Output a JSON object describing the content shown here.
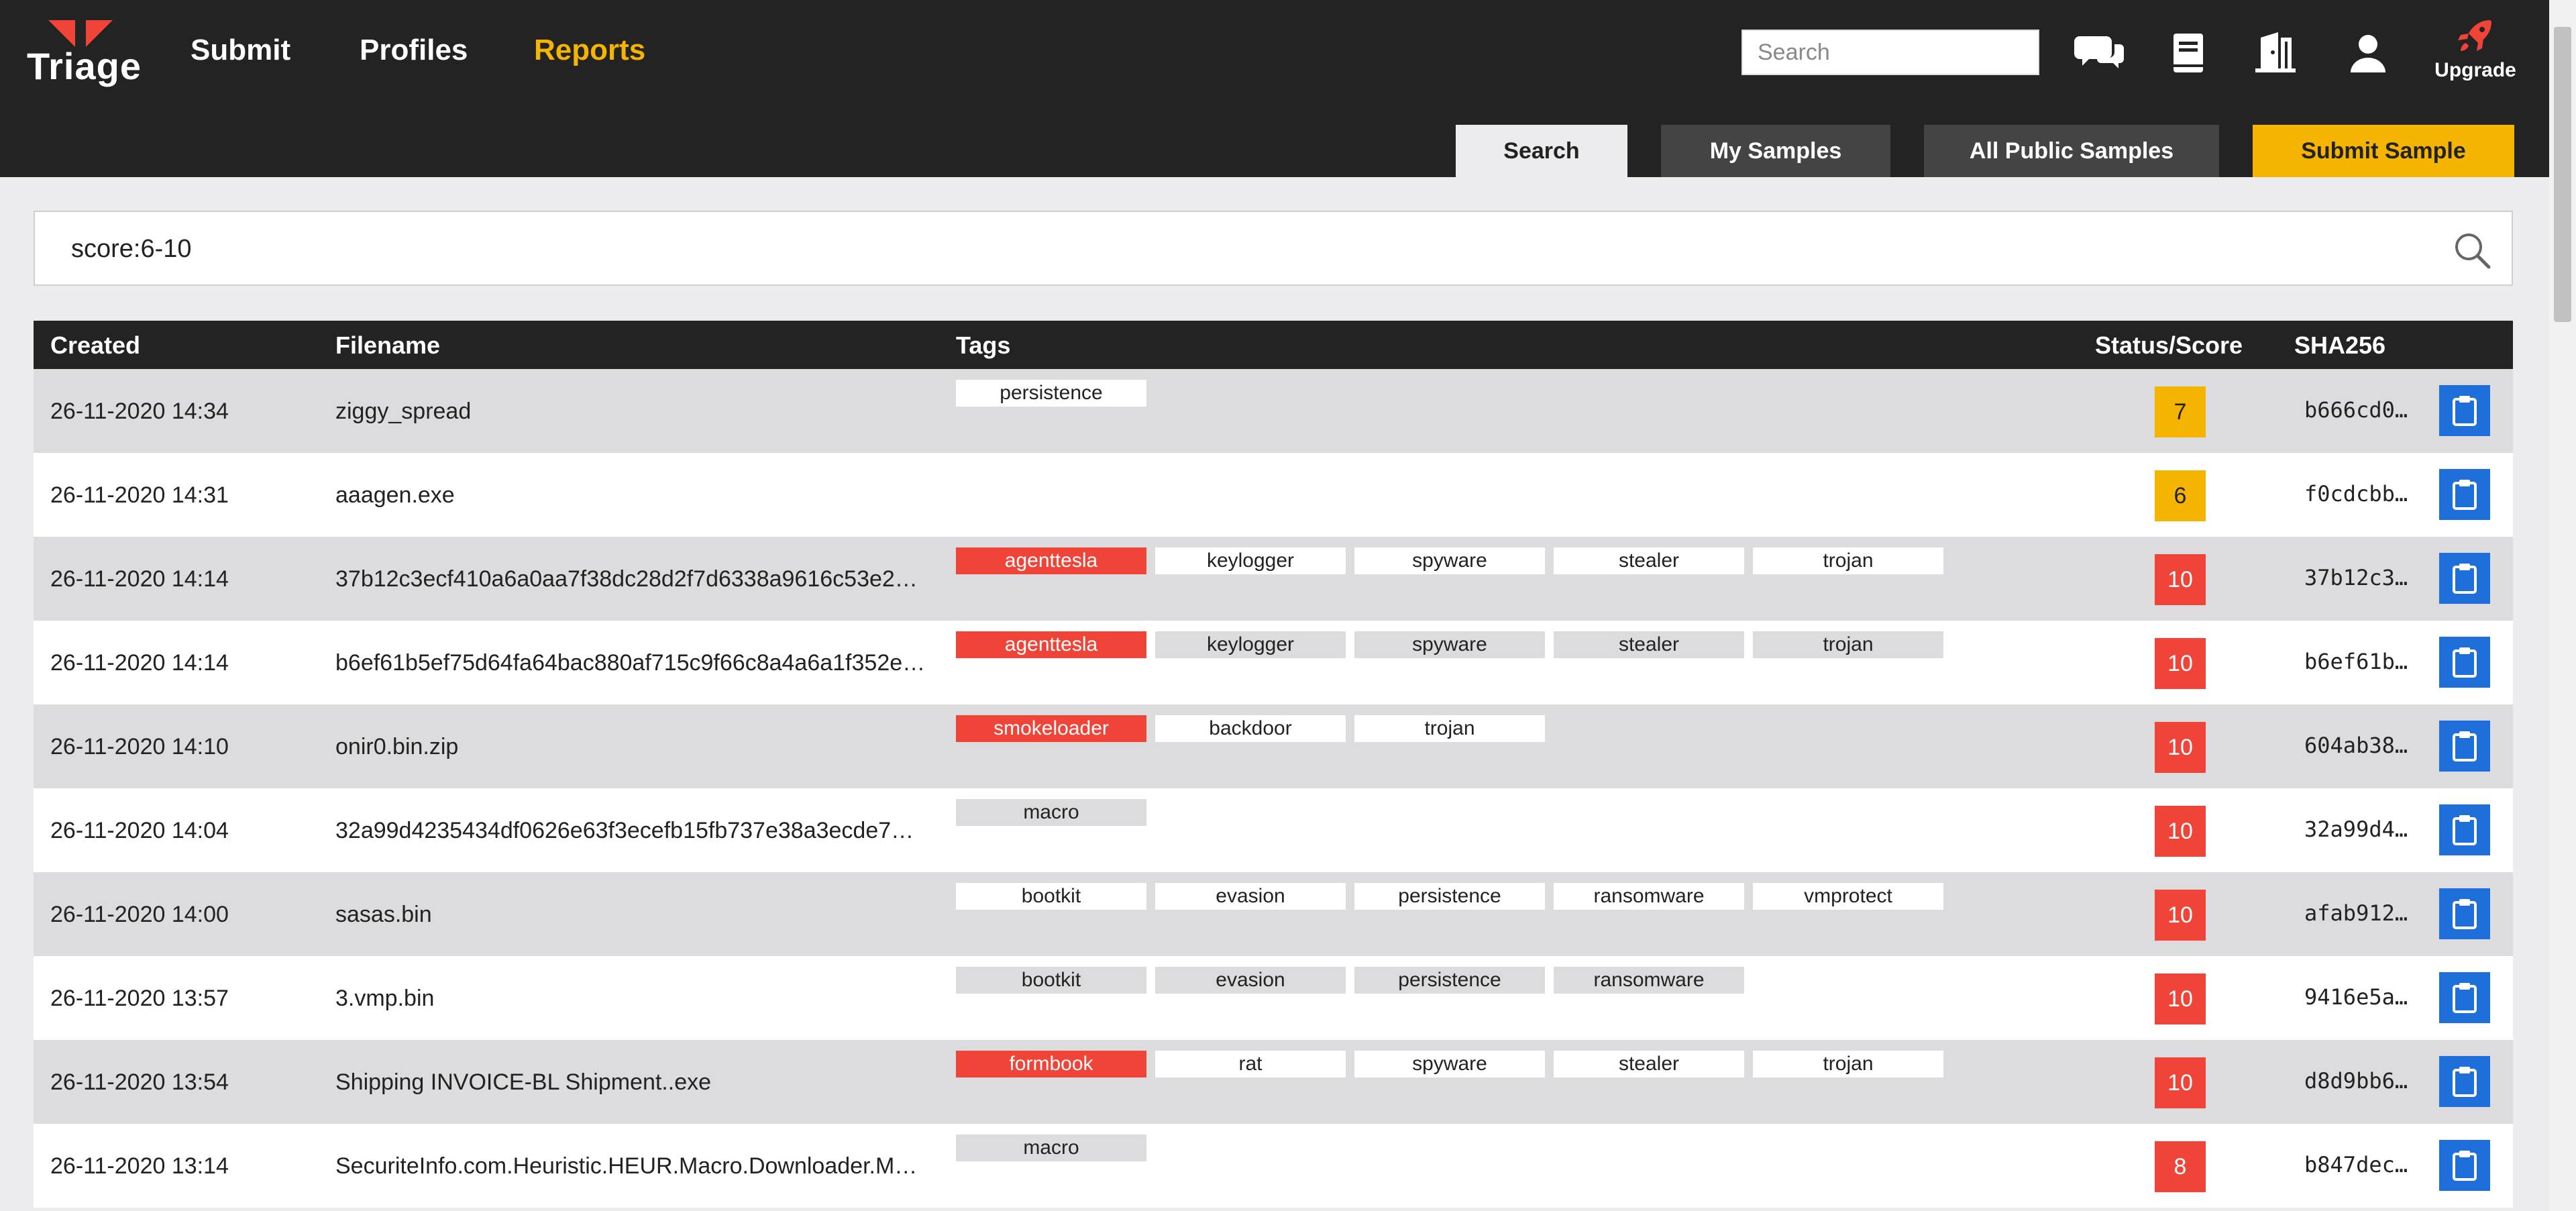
{
  "brand": {
    "name": "Triage",
    "accent": "#f04438"
  },
  "nav": {
    "links": [
      {
        "label": "Submit",
        "active": false
      },
      {
        "label": "Profiles",
        "active": false
      },
      {
        "label": "Reports",
        "active": true
      }
    ]
  },
  "header": {
    "search_placeholder": "Search",
    "icons": [
      "chat-icon",
      "book-icon",
      "door-icon",
      "user-icon",
      "rocket-icon"
    ],
    "upgrade_label": "Upgrade"
  },
  "tabs": [
    {
      "label": "Search",
      "selected": true
    },
    {
      "label": "My Samples",
      "selected": false
    },
    {
      "label": "All Public Samples",
      "selected": false
    },
    {
      "label": "Submit Sample",
      "highlight": true
    }
  ],
  "query": {
    "value": "score:6-10"
  },
  "table": {
    "columns": [
      "Created",
      "Filename",
      "Tags",
      "Status/Score",
      "SHA256"
    ],
    "rows": [
      {
        "created": "26-11-2020 14:34",
        "filename": "ziggy_spread",
        "tags": [
          {
            "label": "persistence",
            "family": false
          }
        ],
        "score": "7",
        "score_color": "yellow",
        "sha": "b666cd0…"
      },
      {
        "created": "26-11-2020 14:31",
        "filename": "aaagen.exe",
        "tags": [],
        "score": "6",
        "score_color": "yellow",
        "sha": "f0cdcbb…"
      },
      {
        "created": "26-11-2020 14:14",
        "filename": "37b12c3ecf410a6a0aa7f38dc28d2f7d6338a9616c53e2…",
        "tags": [
          {
            "label": "agenttesla",
            "family": true
          },
          {
            "label": "keylogger",
            "family": false
          },
          {
            "label": "spyware",
            "family": false
          },
          {
            "label": "stealer",
            "family": false
          },
          {
            "label": "trojan",
            "family": false
          }
        ],
        "score": "10",
        "score_color": "red",
        "sha": "37b12c3…"
      },
      {
        "created": "26-11-2020 14:14",
        "filename": "b6ef61b5ef75d64fa64bac880af715c9f66c8a4a6a1f352e…",
        "tags": [
          {
            "label": "agenttesla",
            "family": true
          },
          {
            "label": "keylogger",
            "family": false
          },
          {
            "label": "spyware",
            "family": false
          },
          {
            "label": "stealer",
            "family": false
          },
          {
            "label": "trojan",
            "family": false
          }
        ],
        "score": "10",
        "score_color": "red",
        "sha": "b6ef61b…"
      },
      {
        "created": "26-11-2020 14:10",
        "filename": "onir0.bin.zip",
        "tags": [
          {
            "label": "smokeloader",
            "family": true
          },
          {
            "label": "backdoor",
            "family": false
          },
          {
            "label": "trojan",
            "family": false
          }
        ],
        "score": "10",
        "score_color": "red",
        "sha": "604ab38…"
      },
      {
        "created": "26-11-2020 14:04",
        "filename": "32a99d4235434df0626e63f3ecefb15fb737e38a3ecde7…",
        "tags": [
          {
            "label": "macro",
            "family": false
          }
        ],
        "score": "10",
        "score_color": "red",
        "sha": "32a99d4…"
      },
      {
        "created": "26-11-2020 14:00",
        "filename": "sasas.bin",
        "tags": [
          {
            "label": "bootkit",
            "family": false
          },
          {
            "label": "evasion",
            "family": false
          },
          {
            "label": "persistence",
            "family": false
          },
          {
            "label": "ransomware",
            "family": false
          },
          {
            "label": "vmprotect",
            "family": false
          }
        ],
        "score": "10",
        "score_color": "red",
        "sha": "afab912…"
      },
      {
        "created": "26-11-2020 13:57",
        "filename": "3.vmp.bin",
        "tags": [
          {
            "label": "bootkit",
            "family": false
          },
          {
            "label": "evasion",
            "family": false
          },
          {
            "label": "persistence",
            "family": false
          },
          {
            "label": "ransomware",
            "family": false
          }
        ],
        "score": "10",
        "score_color": "red",
        "sha": "9416e5a…"
      },
      {
        "created": "26-11-2020 13:54",
        "filename": "Shipping INVOICE-BL Shipment..exe",
        "tags": [
          {
            "label": "formbook",
            "family": true
          },
          {
            "label": "rat",
            "family": false
          },
          {
            "label": "spyware",
            "family": false
          },
          {
            "label": "stealer",
            "family": false
          },
          {
            "label": "trojan",
            "family": false
          }
        ],
        "score": "10",
        "score_color": "red",
        "sha": "d8d9bb6…"
      },
      {
        "created": "26-11-2020 13:14",
        "filename": "SecuriteInfo.com.Heuristic.HEUR.Macro.Downloader.M…",
        "tags": [
          {
            "label": "macro",
            "family": false
          }
        ],
        "score": "8",
        "score_color": "red",
        "sha": "b847dec…"
      }
    ]
  },
  "colors": {
    "header_bg": "#232323",
    "active_nav": "#f5b400",
    "score_yellow": "#f5b400",
    "score_red": "#f04438",
    "copy_button": "#1e6fd9"
  }
}
